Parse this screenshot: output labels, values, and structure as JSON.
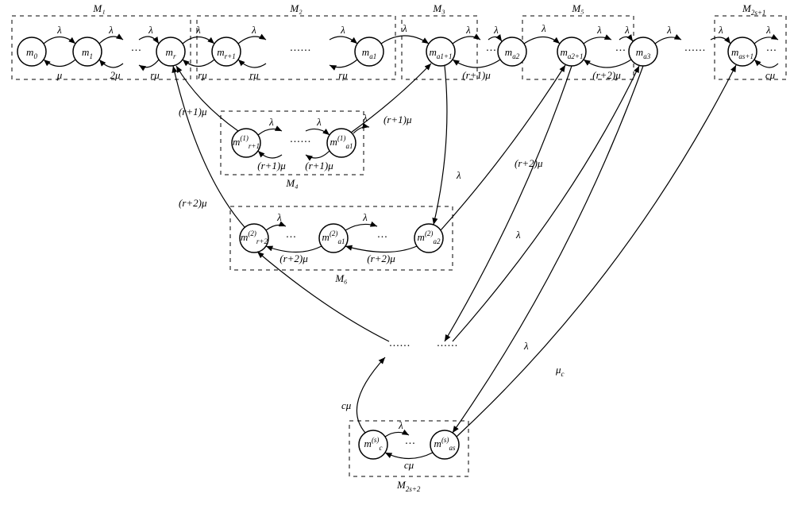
{
  "boxes": {
    "M1": "M₁",
    "M2": "M₂",
    "M3": "M₃",
    "M4": "M₄",
    "M5": "M₅",
    "M6": "M₆",
    "M2s1": "M",
    "M2s1sub": "2s+1",
    "M2s2": "M",
    "M2s2sub": "2s+2"
  },
  "states": {
    "m0": "m",
    "m0s": "0",
    "m1": "m",
    "m1s": "1",
    "mr": "m",
    "mrs": "r",
    "mr1": "m",
    "mr1s": "r+1",
    "ma1": "m",
    "ma1s": "a1",
    "ma11": "m",
    "ma11s": "a1+1",
    "ma2": "m",
    "ma2s": "a2",
    "ma21": "m",
    "ma21s": "a2+1",
    "ma3": "m",
    "ma3s": "a3",
    "mas1": "m",
    "mas1s": "as+1",
    "m4a": "m",
    "m4as": "r+1",
    "m4asup": "(1)",
    "m4b": "m",
    "m4bs": "a1",
    "m4bsup": "(1)",
    "m6a": "m",
    "m6as": "r+2",
    "m6asup": "(2)",
    "m6b": "m",
    "m6bs": "a1",
    "m6bsup": "(2)",
    "m6c": "m",
    "m6cs": "a2",
    "m6csup": "(2)",
    "mbot1": "m",
    "mbot1s": "c",
    "mbot1sup": "(s)",
    "mbot2": "m",
    "mbot2s": "as",
    "mbot2sup": "(s)"
  },
  "rates": {
    "lambda": "λ",
    "mu": "μ",
    "mu2": "2μ",
    "rmu": "rμ",
    "r1mu": "(r+1)μ",
    "r2mu": "(r+2)μ",
    "cmu": "cμ",
    "muc": "μ"
  },
  "rates_sub": {
    "muc": "c"
  }
}
